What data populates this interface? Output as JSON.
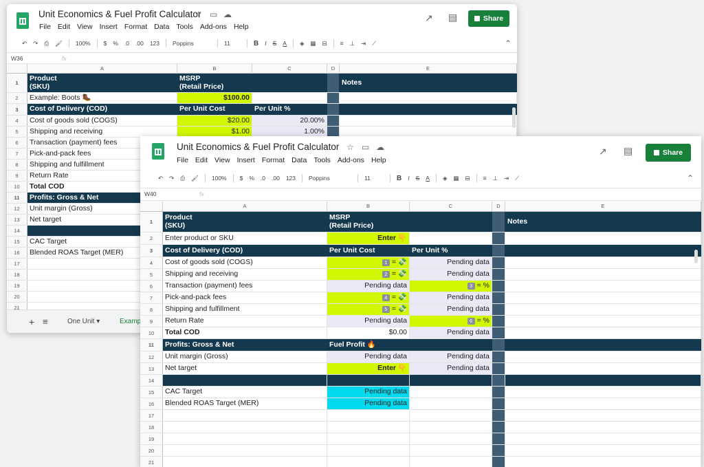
{
  "back": {
    "title": "Unit Economics & Fuel Profit Calculator",
    "menu": [
      "File",
      "Edit",
      "View",
      "Insert",
      "Format",
      "Data",
      "Tools",
      "Add-ons",
      "Help"
    ],
    "share": "Share",
    "toolbar": {
      "zoom": "100%",
      "currency": "$",
      "percent": "%",
      "dec_less": ".0",
      "dec_more": ".00",
      "format": "123",
      "font": "Poppins",
      "size": "11"
    },
    "cell_ref": "W36",
    "fx": "fx",
    "cols": [
      "A",
      "B",
      "C",
      "D",
      "E"
    ],
    "rows": [
      {
        "n": "1",
        "a": "Product\n(SKU)",
        "b": "MSRP\n(Retail Price)",
        "c": "",
        "e": "Notes"
      },
      {
        "n": "2",
        "a": "Example: Boots 🥾",
        "b": "$100.00",
        "c": "",
        "e": ""
      },
      {
        "n": "3",
        "a": "Cost of Delivery (COD)",
        "b": "Per Unit Cost",
        "c": "Per Unit %",
        "e": ""
      },
      {
        "n": "4",
        "a": "Cost of goods sold (COGS)",
        "b": "$20.00",
        "c": "20.00%",
        "e": ""
      },
      {
        "n": "5",
        "a": "Shipping and receiving",
        "b": "$1.00",
        "c": "1.00%",
        "e": ""
      },
      {
        "n": "6",
        "a": "Transaction (payment) fees",
        "b": "",
        "c": "",
        "e": ""
      },
      {
        "n": "7",
        "a": "Pick-and-pack fees",
        "b": "",
        "c": "",
        "e": ""
      },
      {
        "n": "8",
        "a": "Shipping and fulfillment",
        "b": "",
        "c": "",
        "e": ""
      },
      {
        "n": "9",
        "a": "Return Rate",
        "b": "",
        "c": "",
        "e": ""
      },
      {
        "n": "10",
        "a": "Total COD",
        "b": "",
        "c": "",
        "e": ""
      },
      {
        "n": "11",
        "a": "Profits: Gross & Net",
        "b": "",
        "c": "",
        "e": ""
      },
      {
        "n": "12",
        "a": "Unit margin (Gross)",
        "b": "",
        "c": "",
        "e": ""
      },
      {
        "n": "13",
        "a": "Net target",
        "b": "",
        "c": "",
        "e": ""
      },
      {
        "n": "14",
        "a": "",
        "b": "",
        "c": "",
        "e": ""
      },
      {
        "n": "15",
        "a": "CAC Target",
        "b": "",
        "c": "",
        "e": ""
      },
      {
        "n": "16",
        "a": "Blended ROAS Target (MER)",
        "b": "",
        "c": "",
        "e": ""
      },
      {
        "n": "17",
        "a": "",
        "b": "",
        "c": "",
        "e": ""
      },
      {
        "n": "18",
        "a": "",
        "b": "",
        "c": "",
        "e": ""
      },
      {
        "n": "19",
        "a": "",
        "b": "",
        "c": "",
        "e": ""
      },
      {
        "n": "20",
        "a": "",
        "b": "",
        "c": "",
        "e": ""
      },
      {
        "n": "21",
        "a": "",
        "b": "",
        "c": "",
        "e": ""
      }
    ],
    "tabs": {
      "add": "+",
      "list": "≡",
      "tab1": "One Unit",
      "tab2": "Examp"
    }
  },
  "front": {
    "title": "Unit Economics & Fuel Profit Calculator",
    "menu": [
      "File",
      "Edit",
      "View",
      "Insert",
      "Format",
      "Data",
      "Tools",
      "Add-ons",
      "Help"
    ],
    "share": "Share",
    "toolbar": {
      "zoom": "100%",
      "currency": "$",
      "percent": "%",
      "dec_less": ".0",
      "dec_more": ".00",
      "format": "123",
      "font": "Poppins",
      "size": "11"
    },
    "cell_ref": "W40",
    "fx": "fx",
    "cols": [
      "A",
      "B",
      "C",
      "D",
      "E"
    ],
    "rows": [
      {
        "n": "1",
        "a": "Product\n(SKU)",
        "b": "MSRP\n(Retail Price)",
        "c": "",
        "e": "Notes"
      },
      {
        "n": "2",
        "a": "Enter product or SKU",
        "b": "Enter 👇",
        "c": "",
        "e": ""
      },
      {
        "n": "3",
        "a": "Cost of Delivery (COD)",
        "b": "Per Unit Cost",
        "c": "Per Unit %",
        "e": ""
      },
      {
        "n": "4",
        "a": "Cost of goods sold (COGS)",
        "bbadge": "1",
        "b": "= 💸",
        "c": "Pending data",
        "e": ""
      },
      {
        "n": "5",
        "a": "Shipping and receiving",
        "bbadge": "2",
        "b": "= 💸",
        "c": "Pending data",
        "e": ""
      },
      {
        "n": "6",
        "a": "Transaction (payment) fees",
        "b": "Pending data",
        "cbadge": "3",
        "c": "= %",
        "e": ""
      },
      {
        "n": "7",
        "a": "Pick-and-pack fees",
        "bbadge": "4",
        "b": "= 💸",
        "c": "Pending data",
        "e": ""
      },
      {
        "n": "8",
        "a": "Shipping and fulfillment",
        "bbadge": "5",
        "b": "= 💸",
        "c": "Pending data",
        "e": ""
      },
      {
        "n": "9",
        "a": "Return Rate",
        "b": "Pending data",
        "cbadge": "6",
        "c": "= %",
        "e": ""
      },
      {
        "n": "10",
        "a": "Total COD",
        "b": "$0.00",
        "c": "Pending data",
        "e": ""
      },
      {
        "n": "11",
        "a": "Profits: Gross & Net",
        "b": "Fuel Profit 🔥",
        "c": "",
        "e": ""
      },
      {
        "n": "12",
        "a": "Unit margin (Gross)",
        "b": "Pending data",
        "c": "Pending data",
        "e": ""
      },
      {
        "n": "13",
        "a": "Net target",
        "b": "Enter 👇",
        "c": "Pending data",
        "e": ""
      },
      {
        "n": "14",
        "a": "",
        "b": "",
        "c": "",
        "e": ""
      },
      {
        "n": "15",
        "a": "CAC Target",
        "b": "Pending data",
        "c": "",
        "e": ""
      },
      {
        "n": "16",
        "a": "Blended ROAS Target (MER)",
        "b": "Pending data",
        "c": "",
        "e": ""
      },
      {
        "n": "17",
        "a": "",
        "b": "",
        "c": "",
        "e": ""
      },
      {
        "n": "18",
        "a": "",
        "b": "",
        "c": "",
        "e": ""
      },
      {
        "n": "19",
        "a": "",
        "b": "",
        "c": "",
        "e": ""
      },
      {
        "n": "20",
        "a": "",
        "b": "",
        "c": "",
        "e": ""
      },
      {
        "n": "21",
        "a": "",
        "b": "",
        "c": "",
        "e": ""
      }
    ]
  },
  "colors": {
    "header_navy": "#14394f",
    "column_d": "#3f5d74",
    "lime_input": "#d2f700",
    "cyan_output": "#00d9ee",
    "pending": "#ece9f7",
    "share_green": "#188038"
  }
}
